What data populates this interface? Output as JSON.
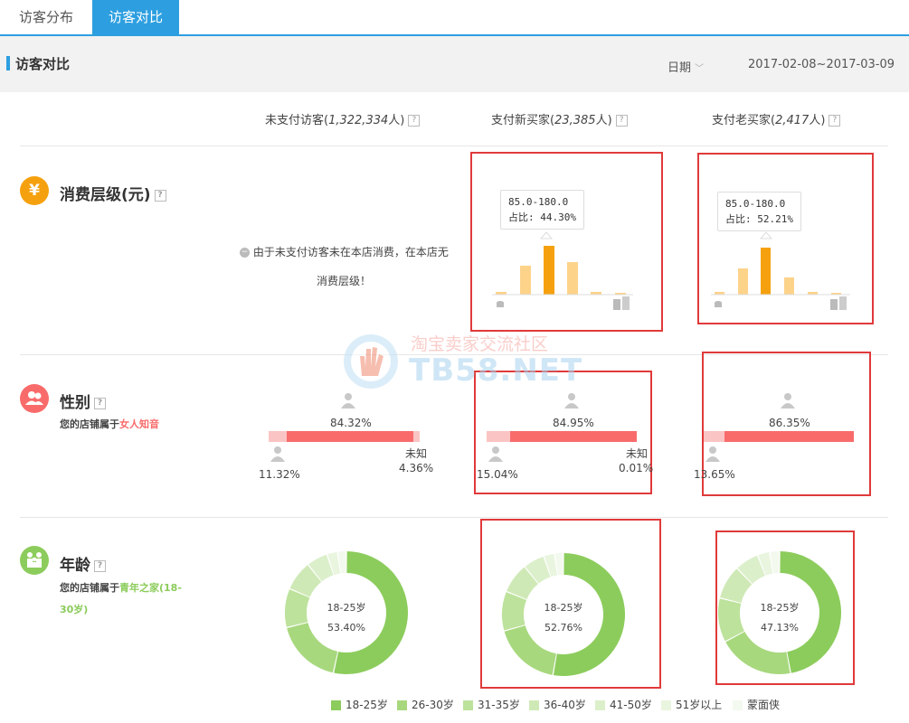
{
  "tabs": [
    {
      "label": "访客分布",
      "active": false
    },
    {
      "label": "访客对比",
      "active": true
    }
  ],
  "header": {
    "title": "访客对比",
    "date_label": "日期",
    "date_range": "2017-02-08~2017-03-09"
  },
  "columns": [
    {
      "label": "未支付访客",
      "count": "1,322,334",
      "unit": "人"
    },
    {
      "label": "支付新买家",
      "count": "23,385",
      "unit": "人"
    },
    {
      "label": "支付老买家",
      "count": "2,417",
      "unit": "人"
    }
  ],
  "spending": {
    "title": "消费层级(元)",
    "icon": "yen-icon",
    "unpaid_note_line1": "由于未支付访客未在本店消费，在本店无",
    "unpaid_note_line2": "消费层级！",
    "new_buyers": {
      "tooltip_range": "85.0-180.0",
      "tooltip_share": "占比: 44.30%"
    },
    "old_buyers": {
      "tooltip_range": "85.0-180.0",
      "tooltip_share": "占比: 52.21%"
    }
  },
  "gender": {
    "title": "性别",
    "subtitle_prefix": "您的店铺属于",
    "subtitle_highlight": "女人知音",
    "unknown_label": "未知",
    "unpaid": {
      "female": "84.32%",
      "male": "11.32%",
      "unknown": "4.36%"
    },
    "new_buyers": {
      "female": "84.95%",
      "male": "15.04%",
      "unknown": "0.01%"
    },
    "old_buyers": {
      "female": "86.35%",
      "male": "13.65%"
    }
  },
  "age": {
    "title": "年龄",
    "subtitle_prefix": "您的店铺属于",
    "subtitle_highlight_1": "青年之家(18-",
    "subtitle_highlight_2": "30岁)",
    "center_label": "18-25岁",
    "unpaid_center": "53.40%",
    "new_center": "52.76%",
    "old_center": "47.13%",
    "legend": [
      "18-25岁",
      "26-30岁",
      "31-35岁",
      "36-40岁",
      "41-50岁",
      "51岁以上",
      "蒙面侠"
    ]
  },
  "colors": {
    "accent_blue": "#2d9fe0",
    "bar_orange": "#f5a10f",
    "bar_light_orange": "#fdd38a",
    "female_red": "#f96b6b",
    "male_pink": "#fbc4c4",
    "age_green": [
      "#8ccc5c",
      "#a8d87e",
      "#bde29c",
      "#cfe9b6",
      "#dcefcb",
      "#e9f5df",
      "#f3f9ee"
    ],
    "red_box": "#e03a3a"
  },
  "watermark": {
    "line1": "淘宝卖家交流社区",
    "line2": "TB58.NET"
  }
}
